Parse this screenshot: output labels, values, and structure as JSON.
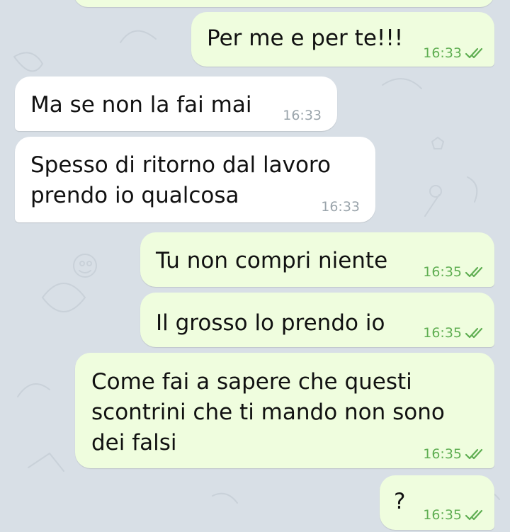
{
  "colors": {
    "outgoing_bubble": "#effdde",
    "incoming_bubble": "#ffffff",
    "outgoing_time": "#5fae52",
    "incoming_time": "#9aa4ab",
    "background": "#d8dfe6"
  },
  "messages": [
    {
      "direction": "out",
      "text": "",
      "time": "",
      "read": false
    },
    {
      "direction": "out",
      "text": "Per me e per te!!!",
      "time": "16:33",
      "read": true
    },
    {
      "direction": "in",
      "text": "Ma se non la fai mai",
      "time": "16:33"
    },
    {
      "direction": "in",
      "text": "Spesso di ritorno dal lavoro\nprendo io qualcosa",
      "time": "16:33"
    },
    {
      "direction": "out",
      "text": "Tu non compri niente",
      "time": "16:35",
      "read": true
    },
    {
      "direction": "out",
      "text": "Il grosso lo prendo io",
      "time": "16:35",
      "read": true
    },
    {
      "direction": "out",
      "text": "Come fai a sapere che questi\nscontrini che ti mando non sono\ndei falsi",
      "time": "16:35",
      "read": true
    },
    {
      "direction": "out",
      "text": "?",
      "time": "16:35",
      "read": true
    }
  ],
  "icons": {
    "read_receipt": "double-check-icon"
  }
}
